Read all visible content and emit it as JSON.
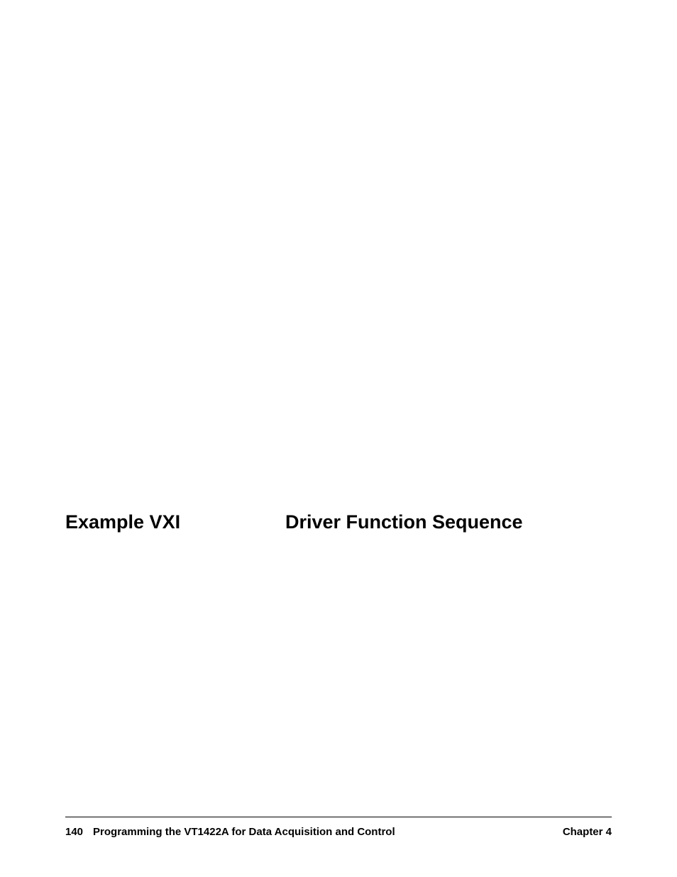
{
  "heading": {
    "left": "Example VXI",
    "right": "Driver Function Sequence"
  },
  "footer": {
    "pageNumber": "140",
    "title": "Programming the VT1422A for Data Acquisition and Control",
    "chapter": "Chapter 4"
  }
}
